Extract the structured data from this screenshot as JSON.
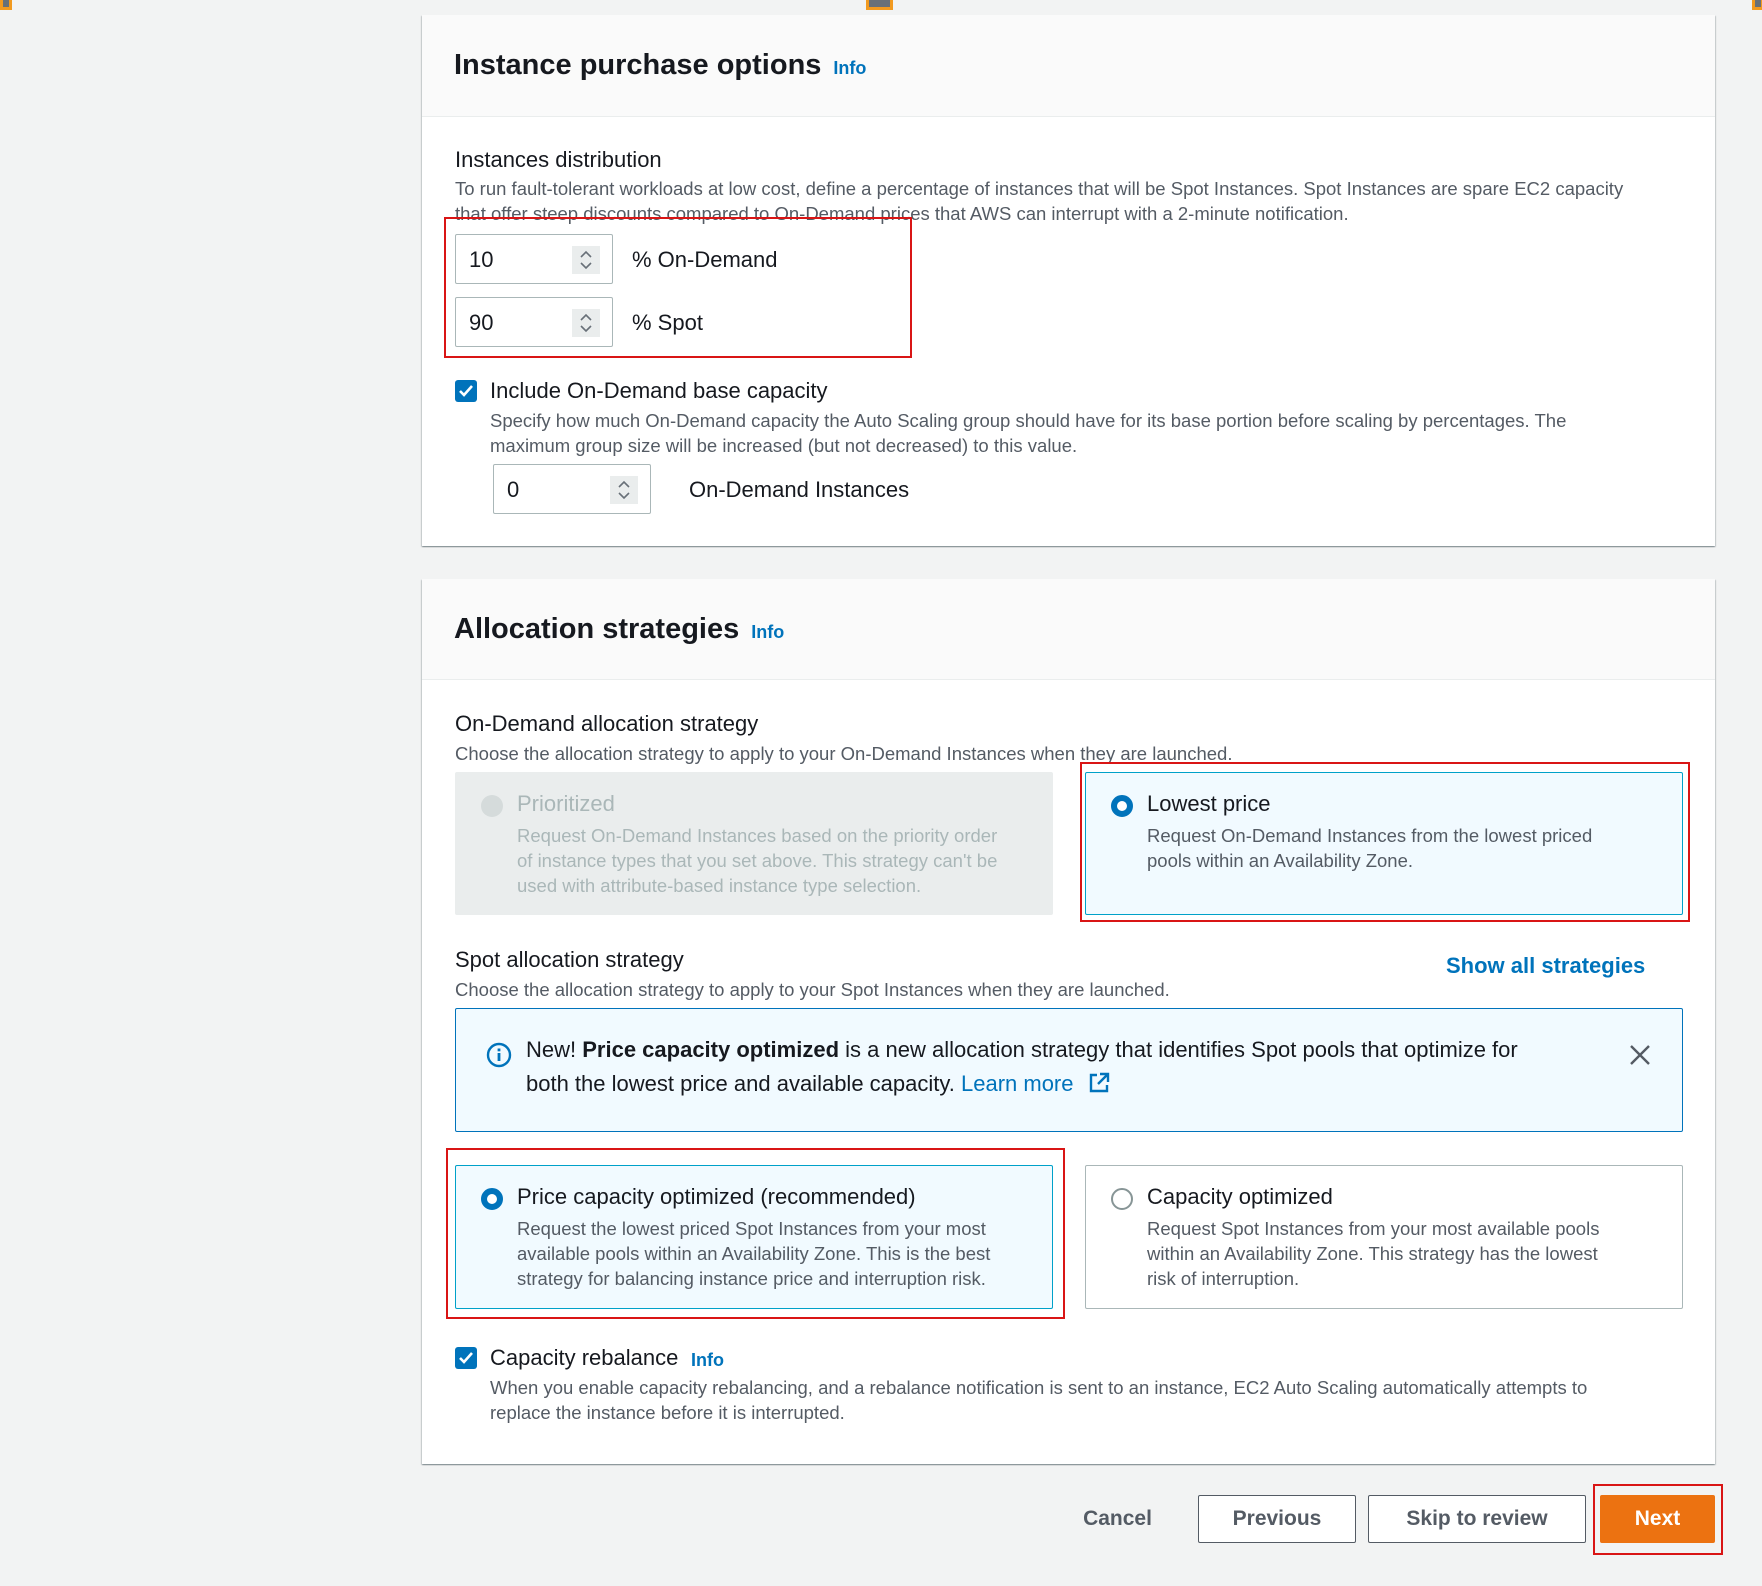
{
  "purchase_options": {
    "title": "Instance purchase options",
    "info": "Info",
    "distribution_label": "Instances distribution",
    "distribution_desc_1": "To run fault-tolerant workloads at low cost, define a percentage of instances that will be Spot Instances. Spot Instances are spare EC2 capacity",
    "distribution_desc_2": "that offer steep discounts compared to On-Demand prices that AWS can interrupt with a 2-minute notification.",
    "on_demand_percent": "10",
    "on_demand_suffix": "% On-Demand",
    "spot_percent": "90",
    "spot_suffix": "% Spot",
    "base_capacity_label": "Include On-Demand base capacity",
    "base_capacity_checked": true,
    "base_capacity_desc_1": "Specify how much On-Demand capacity the Auto Scaling group should have for its base portion before scaling by percentages. The",
    "base_capacity_desc_2": "maximum group size will be increased (but not decreased) to this value.",
    "base_capacity_value": "0",
    "base_capacity_suffix": "On-Demand Instances"
  },
  "allocation": {
    "title": "Allocation strategies",
    "info": "Info",
    "on_demand_label": "On-Demand allocation strategy",
    "on_demand_desc": "Choose the allocation strategy to apply to your On-Demand Instances when they are launched.",
    "on_demand_options": [
      {
        "title": "Prioritized",
        "desc_1": "Request On-Demand Instances based on the priority order",
        "desc_2": "of instance types that you set above. This strategy can't be",
        "desc_3": "used with attribute-based instance type selection.",
        "state": "disabled"
      },
      {
        "title": "Lowest price",
        "desc_1": "Request On-Demand Instances from the lowest priced",
        "desc_2": "pools within an Availability Zone.",
        "state": "selected"
      }
    ],
    "spot_label": "Spot allocation strategy",
    "spot_desc": "Choose the allocation strategy to apply to your Spot Instances when they are launched.",
    "show_all": "Show all strategies",
    "alert": {
      "prefix": "New!",
      "bold": "Price capacity optimized",
      "text": "is a new allocation strategy that identifies Spot pools that optimize for",
      "text_2": "both the lowest price and available capacity.",
      "link": "Learn more"
    },
    "spot_options": [
      {
        "title": "Price capacity optimized (recommended)",
        "desc_1": "Request the lowest priced Spot Instances from your most",
        "desc_2": "available pools within an Availability Zone. This is the best",
        "desc_3": "strategy for balancing instance price and interruption risk.",
        "state": "selected"
      },
      {
        "title": "Capacity optimized",
        "desc_1": "Request Spot Instances from your most available pools",
        "desc_2": "within an Availability Zone. This strategy has the lowest",
        "desc_3": "risk of interruption.",
        "state": "unselected"
      }
    ],
    "rebalance_label": "Capacity rebalance",
    "rebalance_info": "Info",
    "rebalance_checked": true,
    "rebalance_desc_1": "When you enable capacity rebalancing, and a rebalance notification is sent to an instance, EC2 Auto Scaling automatically attempts to",
    "rebalance_desc_2": "replace the instance before it is interrupted."
  },
  "footer": {
    "cancel": "Cancel",
    "previous": "Previous",
    "skip": "Skip to review",
    "next": "Next"
  },
  "colors": {
    "primary": "#ec7211",
    "link": "#0073bb",
    "highlight": "#d91515"
  }
}
